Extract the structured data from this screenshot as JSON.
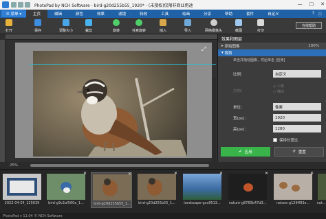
{
  "app": {
    "window_title": "PhotoPad by NCH Software - bird-g20d255b55_1920* - (未授权)仅限非商业用途",
    "min_icon": "minimize-icon",
    "max_icon": "maximize-icon",
    "close_icon": "close-icon"
  },
  "menubar": {
    "menu_button": "☰ 菜单 ▾",
    "tabs": [
      "主页",
      "编辑",
      "颜色",
      "效果",
      "滤镜",
      "特效",
      "工具",
      "绘画",
      "分享",
      "帮助",
      "套件",
      "自定义"
    ],
    "help_icon": "question-icon",
    "info_icon": "info-icon"
  },
  "ribbon": {
    "buttons": [
      {
        "label": "打开",
        "icon": "open-folder-icon",
        "color": "#e8b13c"
      },
      {
        "label": "保存",
        "icon": "save-icon",
        "color": "#3d8de0"
      },
      {
        "label": "调整大小",
        "icon": "resize-icon",
        "color": "#49a6e8"
      },
      {
        "label": "裁剪",
        "icon": "crop-icon",
        "color": "#4ab2f0"
      },
      {
        "label": "旋转",
        "icon": "rotate-icon",
        "color": "#4fcf6a"
      },
      {
        "label": "任意旋转",
        "icon": "free-rotate-icon",
        "color": "#4fcf6a"
      },
      {
        "label": "插入",
        "icon": "insert-icon",
        "color": "#d8a84a"
      },
      {
        "label": "导入",
        "icon": "import-icon",
        "color": "#6fa9d8"
      },
      {
        "label": "网络摄像头",
        "icon": "webcam-icon",
        "color": "#cfcfcf"
      },
      {
        "label": "截图",
        "icon": "screenshot-icon",
        "color": "#9fc8ef"
      },
      {
        "label": "打印",
        "icon": "print-icon",
        "color": "#d9d9d9"
      }
    ],
    "online_help": "在线帮助"
  },
  "workspace": {
    "zoom": "25%",
    "expand_icon": "expand-icon"
  },
  "panel": {
    "title": "效果和图层",
    "section_original": "原始图像",
    "original_pct": "100%",
    "section_crop": "裁剪",
    "hint": "单击并拖动图像，然后单击 [应用]",
    "ratio_label": "比例：",
    "ratio_value": "自定义",
    "orientation_label": "方向：",
    "orientation_options": [
      "人像",
      "横向"
    ],
    "unit_label": "单位：",
    "unit_value": "像素",
    "width_label": "宽(px)：",
    "width_value": "1920",
    "height_label": "高(px)：",
    "height_value": "1280",
    "keep_ratio": "保持长宽比",
    "apply_label": "应用",
    "reset_label": "重置"
  },
  "filmstrip": {
    "items": [
      {
        "caption": "2022-04-24_125639"
      },
      {
        "caption": "bird-g9c2af560e_1..."
      },
      {
        "caption": "bird-g20d255b55_1..."
      },
      {
        "caption": "bird-g20d255b55_1..."
      },
      {
        "caption": "landscape-gcc8513..."
      },
      {
        "caption": "nature-g8765b47d3..."
      },
      {
        "caption": "nature-g129ff83e..."
      },
      {
        "caption": "nat..."
      }
    ]
  },
  "status": {
    "text": "PhotoPad v 11.04 © NCH Software"
  }
}
